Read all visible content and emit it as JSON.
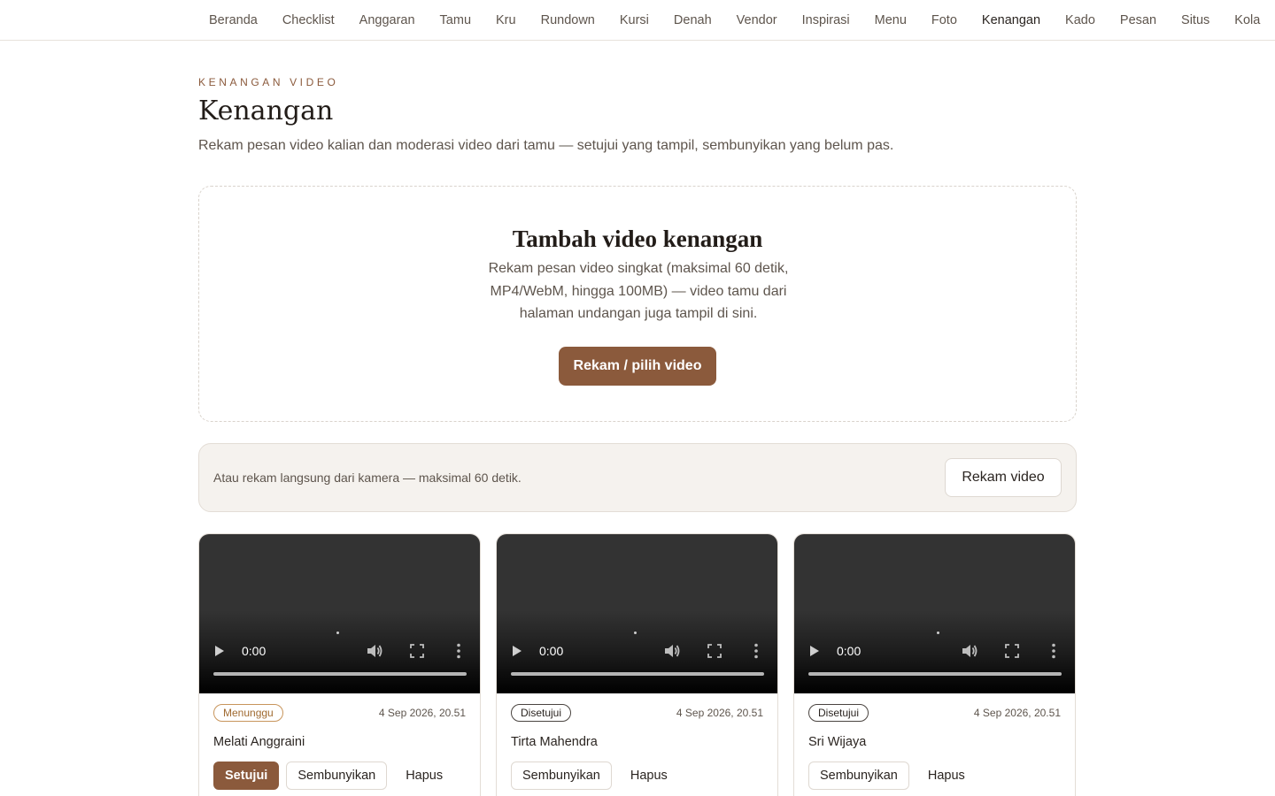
{
  "nav": {
    "items": [
      {
        "label": "Beranda",
        "active": false
      },
      {
        "label": "Checklist",
        "active": false
      },
      {
        "label": "Anggaran",
        "active": false
      },
      {
        "label": "Tamu",
        "active": false
      },
      {
        "label": "Kru",
        "active": false
      },
      {
        "label": "Rundown",
        "active": false
      },
      {
        "label": "Kursi",
        "active": false
      },
      {
        "label": "Denah",
        "active": false
      },
      {
        "label": "Vendor",
        "active": false
      },
      {
        "label": "Inspirasi",
        "active": false
      },
      {
        "label": "Menu",
        "active": false
      },
      {
        "label": "Foto",
        "active": false
      },
      {
        "label": "Kenangan",
        "active": true
      },
      {
        "label": "Kado",
        "active": false
      },
      {
        "label": "Pesan",
        "active": false
      },
      {
        "label": "Situs",
        "active": false
      },
      {
        "label": "Kola",
        "active": false
      }
    ]
  },
  "header": {
    "eyebrow": "KENANGAN VIDEO",
    "title": "Kenangan",
    "subtitle": "Rekam pesan video kalian dan moderasi video dari tamu — setujui yang tampil, sembunyikan yang belum pas."
  },
  "upload": {
    "title": "Tambah video kenangan",
    "description": "Rekam pesan video singkat (maksimal 60 detik, MP4/WebM, hingga 100MB) — video tamu dari halaman undangan juga tampil di sini.",
    "button_label": "Rekam / pilih video"
  },
  "camera": {
    "text": "Atau rekam langsung dari kamera — maksimal 60 detik.",
    "button_label": "Rekam video"
  },
  "labels": {
    "approve": "Setujui",
    "hide": "Sembunyikan",
    "delete": "Hapus"
  },
  "videos": [
    {
      "status": "Menunggu",
      "status_type": "pending",
      "date": "4 Sep 2026, 20.51",
      "name": "Melati Anggraini",
      "time": "0:00",
      "can_approve": true
    },
    {
      "status": "Disetujui",
      "status_type": "approved",
      "date": "4 Sep 2026, 20.51",
      "name": "Tirta Mahendra",
      "time": "0:00",
      "can_approve": false
    },
    {
      "status": "Disetujui",
      "status_type": "approved",
      "date": "4 Sep 2026, 20.51",
      "name": "Sri Wijaya",
      "time": "0:00",
      "can_approve": false
    }
  ],
  "colors": {
    "accent": "#8b5a3c",
    "pending": "#c8955c",
    "text": "#2a2420",
    "muted": "#5e554d"
  },
  "icons": {
    "play": "play-icon",
    "volume": "volume-icon",
    "fullscreen": "fullscreen-icon",
    "more": "more-vertical-icon"
  }
}
